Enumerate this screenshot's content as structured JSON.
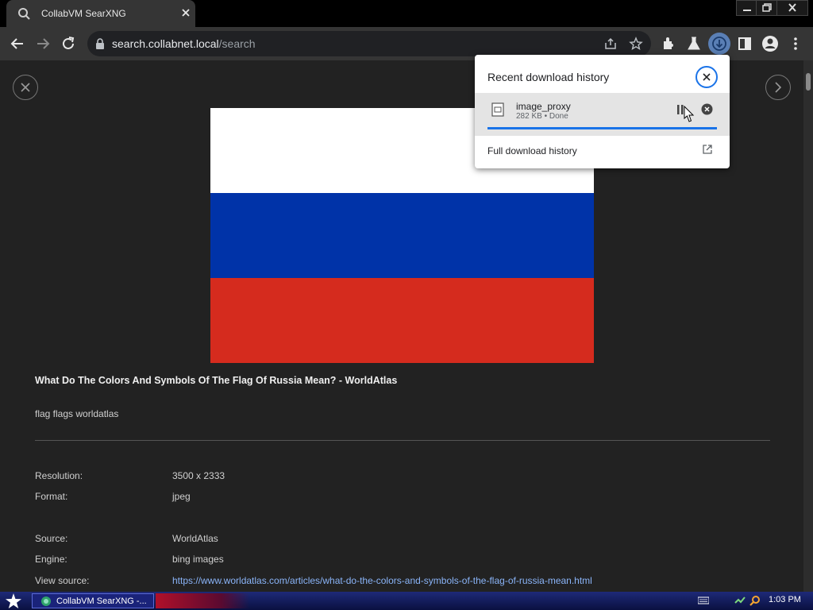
{
  "browser": {
    "tab_title": "CollabVM SearXNG",
    "url_host": "search.collabnet.local",
    "url_path": "/search"
  },
  "page": {
    "result_title": "What Do The Colors And Symbols Of The Flag Of Russia Mean? - WorldAtlas",
    "result_tags": "flag flags worldatlas",
    "flag_colors": [
      "#ffffff",
      "#0033a8",
      "#d52b1e"
    ],
    "details": [
      {
        "label": "Resolution:",
        "value": "3500 x 2333"
      },
      {
        "label": "Format:",
        "value": "jpeg"
      },
      {
        "label": "Source:",
        "value": "WorldAtlas"
      },
      {
        "label": "Engine:",
        "value": "bing images"
      },
      {
        "label": "View source:",
        "value": "https://www.worldatlas.com/articles/what-do-the-colors-and-symbols-of-the-flag-of-russia-mean.html"
      }
    ]
  },
  "downloads_popup": {
    "title": "Recent download history",
    "item_name": "image_proxy",
    "item_status": "282 KB • Done",
    "full_history_label": "Full download history"
  },
  "taskbar": {
    "task_label": "CollabVM SearXNG -...",
    "clock": "1:03 PM"
  },
  "colors": {
    "accent": "#1a73e8",
    "link": "#8ab4f8"
  }
}
